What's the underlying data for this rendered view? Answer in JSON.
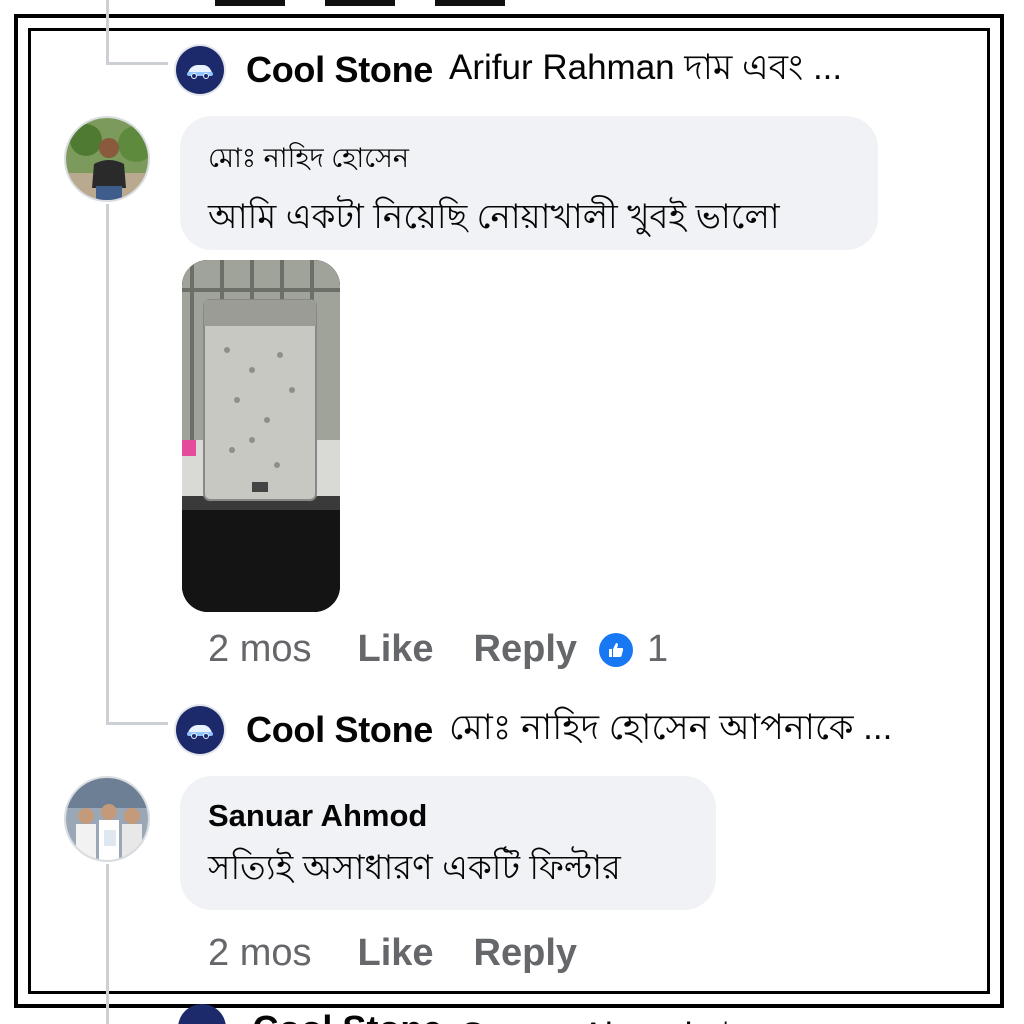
{
  "thread": {
    "reply1": {
      "name": "Cool Stone",
      "text": "Arifur Rahman দাম এবং ..."
    },
    "comment1": {
      "author": "মোঃ নাহিদ হোসেন",
      "text": "আমি একটা নিয়েছি নোয়াখালী খুবই ভালো",
      "time": "2 mos",
      "like_label": "Like",
      "reply_label": "Reply",
      "reaction_count": "1"
    },
    "reply2": {
      "name": "Cool Stone",
      "text": "মোঃ নাহিদ হোসেন আপনাকে ..."
    },
    "comment2": {
      "author": "Sanuar Ahmod",
      "text": "সত্যিই অসাধারণ একটি ফিল্টার",
      "time": "2 mos",
      "like_label": "Like",
      "reply_label": "Reply"
    },
    "reply3": {
      "name": "Cool Stone",
      "text": "Sanuar Ahmod দাম এবং"
    }
  },
  "colors": {
    "bubble": "#f0f2f5",
    "meta_text": "#65676b",
    "like_blue": "#1877f2",
    "brand_avatar": "#1c2a6b"
  },
  "icons": {
    "brand_avatar": "car-logo-icon",
    "reaction": "thumbs-up-icon"
  }
}
